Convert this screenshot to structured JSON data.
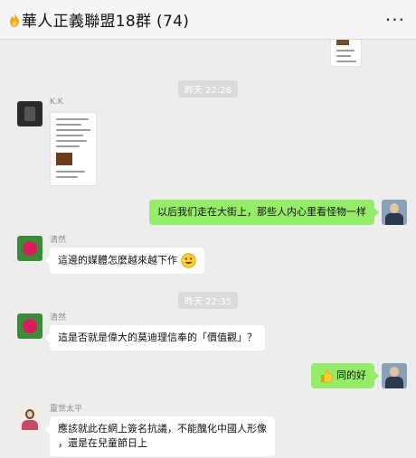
{
  "header": {
    "title": "華人正義聯盟18群 (74)",
    "menu_icon": "more-icon"
  },
  "messages": [
    {
      "type": "image",
      "side": "right",
      "avatar": "none"
    },
    {
      "type": "time",
      "text": "昨天 22:28"
    },
    {
      "type": "image",
      "side": "left",
      "sender": "K.K",
      "avatar": "dark-photo"
    },
    {
      "type": "text",
      "side": "right",
      "text": "以后我们走在大街上，那些人内心里看怪物一样"
    },
    {
      "type": "text",
      "side": "left",
      "sender": "清然",
      "text": "這邊的媒體怎麼越來越下作",
      "emoji": "grin-emoji"
    },
    {
      "type": "time",
      "text": "昨天 22:35"
    },
    {
      "type": "text",
      "side": "left",
      "sender": "清然",
      "text": "這是否就是偉大的莫迪理信奉的「價值觀」？"
    },
    {
      "type": "text",
      "side": "right",
      "text": "同的好",
      "emoji": "thumbs-up-emoji"
    },
    {
      "type": "text",
      "side": "left",
      "sender": "靈世太平",
      "lines": [
        "應該就此在網上簽名抗議，不能醜化中國人形像",
        "，還是在兒童節日上"
      ]
    }
  ],
  "colors": {
    "chat_bg": "#ededed",
    "bubble_self": "#95ec69",
    "bubble_other": "#ffffff"
  }
}
